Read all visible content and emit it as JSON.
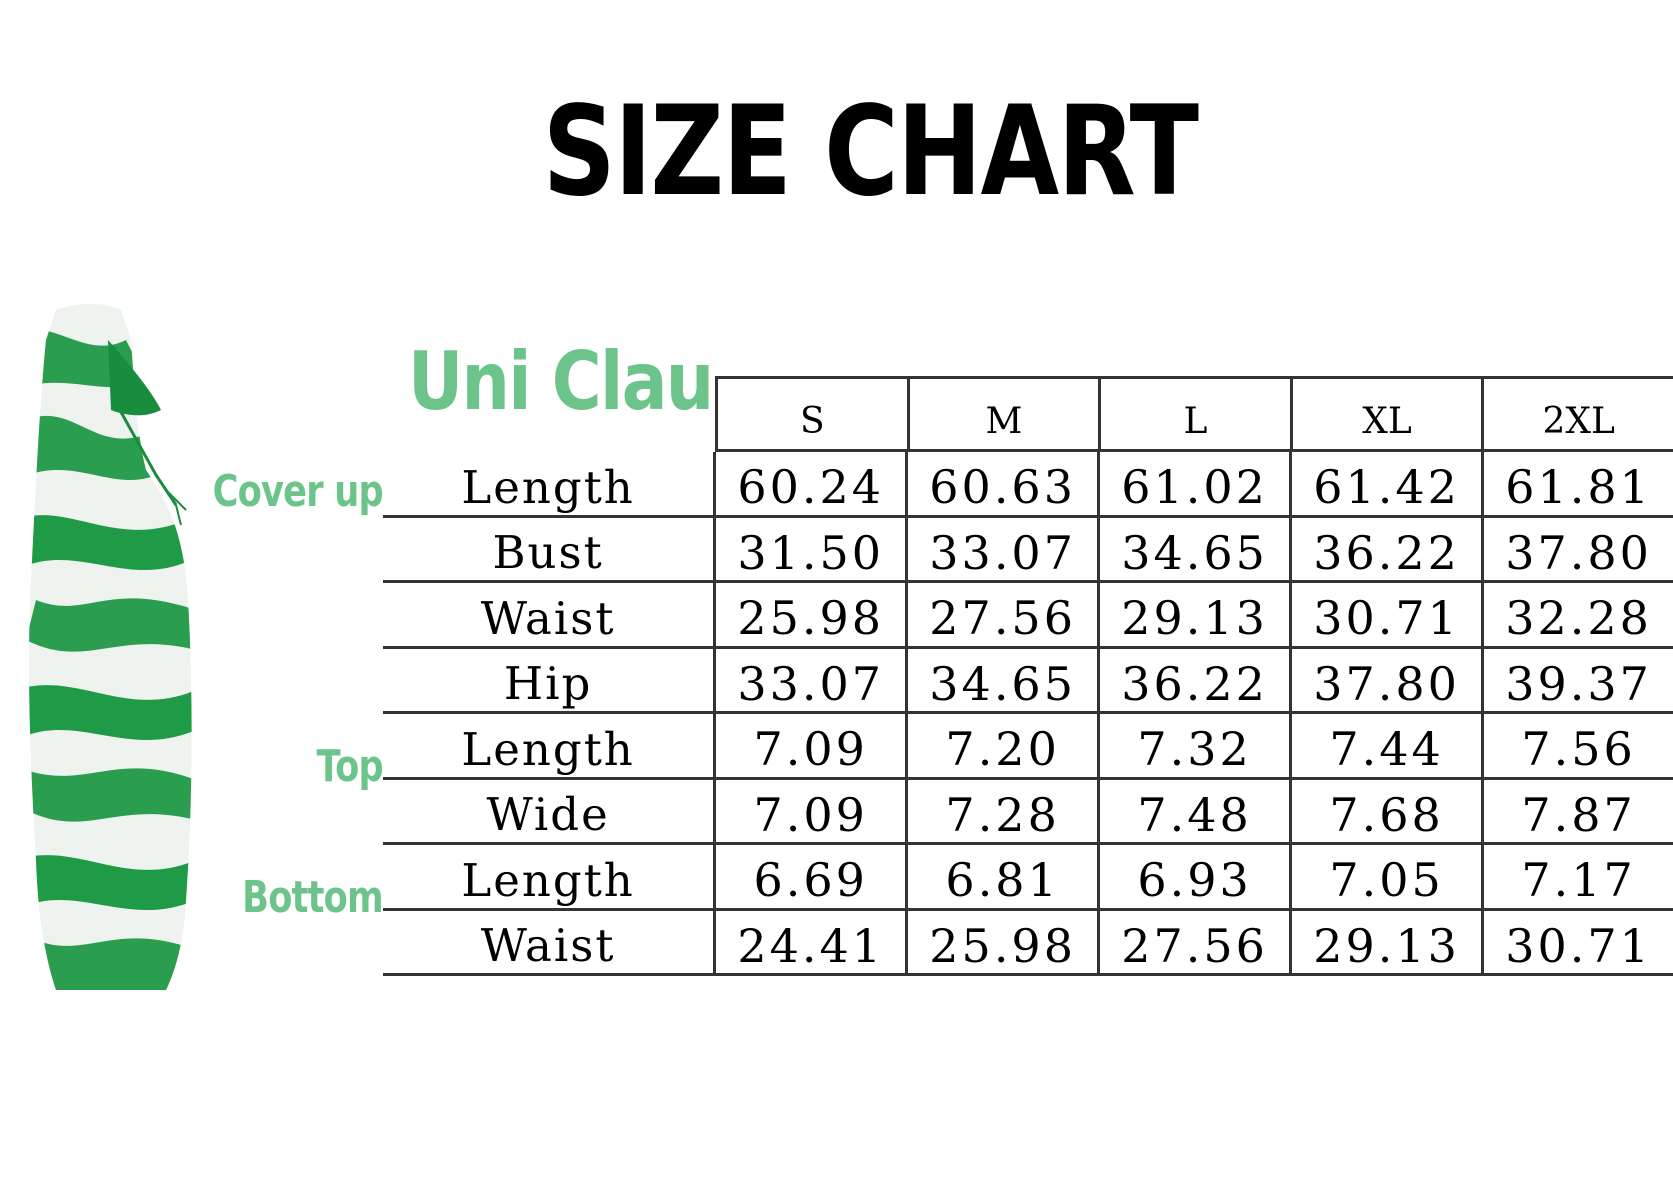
{
  "title": "SIZE CHART",
  "brand": "Uni Clau",
  "colors": {
    "accent_green": "#6cc48a",
    "text": "#000000",
    "rule": "#333333",
    "dress_green": "#1f9a46"
  },
  "group_labels": {
    "cover_up": "Cover up",
    "top": "Top",
    "bottom": "Bottom"
  },
  "columns": [
    "S",
    "M",
    "L",
    "XL",
    "2XL"
  ],
  "rows": [
    {
      "label": "Length",
      "values": [
        "60.24",
        "60.63",
        "61.02",
        "61.42",
        "61.81"
      ]
    },
    {
      "label": "Bust",
      "values": [
        "31.50",
        "33.07",
        "34.65",
        "36.22",
        "37.80"
      ]
    },
    {
      "label": "Waist",
      "values": [
        "25.98",
        "27.56",
        "29.13",
        "30.71",
        "32.28"
      ]
    },
    {
      "label": "Hip",
      "values": [
        "33.07",
        "34.65",
        "36.22",
        "37.80",
        "39.37"
      ]
    },
    {
      "label": "Length",
      "values": [
        "7.09",
        "7.20",
        "7.32",
        "7.44",
        "7.56"
      ]
    },
    {
      "label": "Wide",
      "values": [
        "7.09",
        "7.28",
        "7.48",
        "7.68",
        "7.87"
      ]
    },
    {
      "label": "Length",
      "values": [
        "6.69",
        "6.81",
        "6.93",
        "7.05",
        "7.17"
      ]
    },
    {
      "label": "Waist",
      "values": [
        "24.41",
        "25.98",
        "27.56",
        "29.13",
        "30.71"
      ]
    }
  ]
}
